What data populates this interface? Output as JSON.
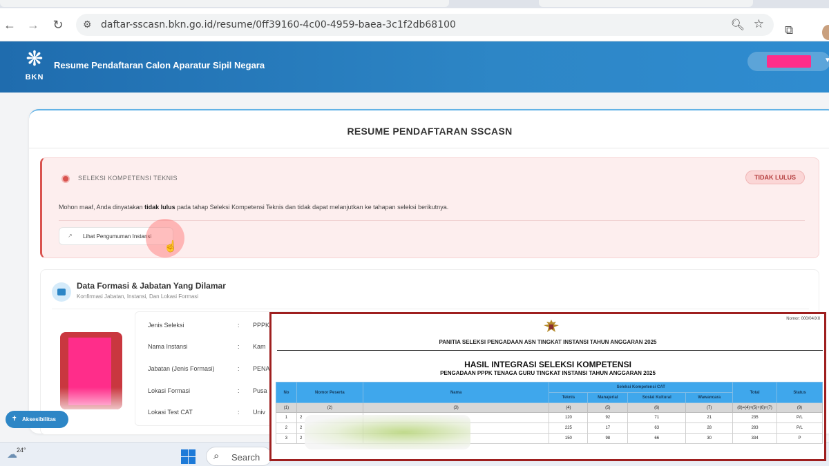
{
  "browser": {
    "url": "daftar-sscasn.bkn.go.id/resume/0ff39160-4c00-4959-baea-3c1f2db68100"
  },
  "header": {
    "logo_text": "BKN",
    "title": "Resume Pendaftaran Calon Aparatur Sipil Negara"
  },
  "card": {
    "title": "RESUME PENDAFTARAN SSCASN",
    "alert": {
      "label": "SELEKSI KOMPETENSI TEKNIS",
      "badge": "TIDAK LULUS",
      "message_before": "Mohon maaf, Anda dinyatakan ",
      "message_bold": "tidak lulus",
      "message_after": " pada tahap Seleksi Kompetensi Teknis dan tidak dapat melanjutkan ke tahapan seleksi berikutnya.",
      "button_label": "Lihat Pengumuman Instansi"
    },
    "section": {
      "title": "Data Formasi & Jabatan Yang Dilamar",
      "subtitle": "Konfirmasi Jabatan, Instansi, Dan Lokasi Formasi",
      "fields": [
        {
          "label": "Jenis Seleksi",
          "value": "PPPK"
        },
        {
          "label": "Nama Instansi",
          "value": "Kam"
        },
        {
          "label": "Jabatan (Jenis Formasi)",
          "value": "PENA"
        },
        {
          "label": "Lokasi Formasi",
          "value": "Pusa"
        },
        {
          "label": "Lokasi Test CAT",
          "value": "Univ"
        }
      ]
    }
  },
  "accessibility": {
    "label": "Aksesibilitas"
  },
  "taskbar": {
    "temperature": "24°",
    "search_label": "Search"
  },
  "overlay": {
    "doc_number": "Nomor: 000/04/XII",
    "committee": "PANITIA SELEKSI PENGADAAN ASN TINGKAT INSTANSI TAHUN ANGGARAN 2025",
    "title": "HASIL INTEGRASI SELEKSI KOMPETENSI",
    "subtitle": "PENGADAAN PPPK TENAGA GURU TINGKAT INSTANSI TAHUN ANGGARAN 2025",
    "headers": {
      "no": "No",
      "nomor_peserta": "Nomor Peserta",
      "nama": "Nama",
      "group": "Seleksi Kompetensi CAT",
      "teknis": "Teknis",
      "manajerial": "Manajerial",
      "sosial_kultural": "Sosial Kultural",
      "wawancara": "Wawancara",
      "total": "Total",
      "status": "Status"
    },
    "index_row": [
      "(1)",
      "(2)",
      "(3)",
      "(4)",
      "(5)",
      "(6)",
      "(7)",
      "(8)=(4)+(5)+(6)+(7)",
      "(9)"
    ],
    "rows": [
      {
        "no": "1",
        "peserta": "2",
        "teknis": "120",
        "manajerial": "92",
        "sosial": "71",
        "wawancara": "21",
        "total": "235",
        "status": "P/L"
      },
      {
        "no": "2",
        "peserta": "2",
        "teknis": "225",
        "manajerial": "17",
        "sosial": "63",
        "wawancara": "28",
        "total": "283",
        "status": "P/L"
      },
      {
        "no": "3",
        "peserta": "2",
        "teknis": "150",
        "manajerial": "98",
        "sosial": "66",
        "wawancara": "30",
        "total": "334",
        "status": "P"
      }
    ]
  }
}
